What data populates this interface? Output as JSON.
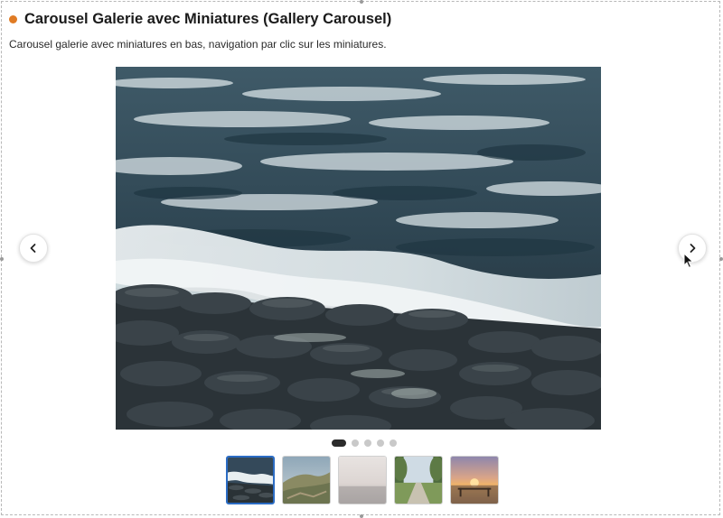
{
  "header": {
    "title": "Carousel Galerie avec Miniatures (Gallery Carousel)",
    "description": "Carousel galerie avec miniatures en bas, navigation par clic sur les miniatures."
  },
  "colors": {
    "status_dot": "#e07b24",
    "active_thumb_border": "#2b6cc4",
    "active_dot": "#2b2b2b",
    "inactive_dot": "#c9c9c9"
  },
  "carousel": {
    "current_slide": 1,
    "total_slides": 5,
    "prev_icon": "chevron-left-icon",
    "next_icon": "chevron-right-icon",
    "slides": [
      {
        "subject": "ocean waves over dark rocks"
      },
      {
        "subject": "hillside"
      },
      {
        "subject": "misty horizon"
      },
      {
        "subject": "path through trees"
      },
      {
        "subject": "sunset over water"
      }
    ]
  }
}
